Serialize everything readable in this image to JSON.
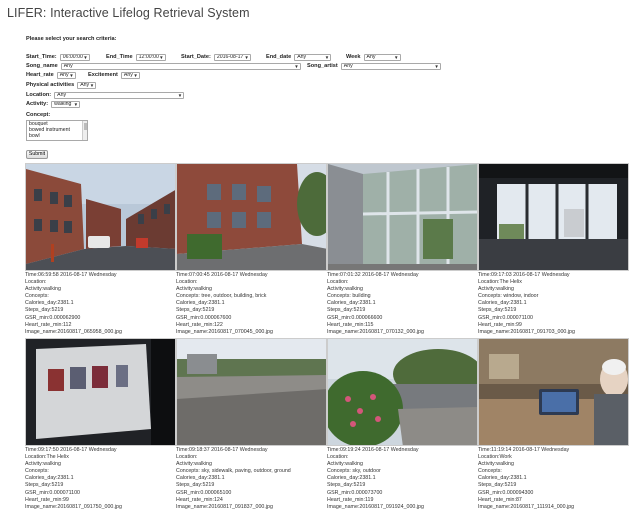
{
  "app": {
    "title": "LIFER: Interactive Lifelog Retrieval System"
  },
  "form": {
    "prompt": "Please select your search criteria:",
    "start_time": {
      "label": "Start_Time:",
      "value": "06:00:00"
    },
    "end_time": {
      "label": "End_Time",
      "value": "12:00:00"
    },
    "start_date": {
      "label": "Start_Date:",
      "value": "2016-08-17"
    },
    "end_date": {
      "label": "End_date",
      "value": "Any"
    },
    "week": {
      "label": "Week",
      "value": "Any"
    },
    "song_name": {
      "label": "Song_name",
      "value": "Any"
    },
    "song_artist": {
      "label": "Song_artist",
      "value": "Any"
    },
    "heart_rate": {
      "label": "Heart_rate",
      "value": "Any"
    },
    "excitement": {
      "label": "Excitement",
      "value": "Any"
    },
    "physical_activities": {
      "label": "Physical activities",
      "value": "Any"
    },
    "location": {
      "label": "Location:",
      "value": "Any"
    },
    "activity": {
      "label": "Activity:",
      "value": "walking"
    },
    "concept": {
      "label": "Concept:",
      "options": [
        "bouquet",
        "bowed instrument",
        "bowl"
      ]
    },
    "submit_label": "Submit"
  },
  "results": [
    {
      "time": "Time:06:59:58  2016-08-17  Wednesday",
      "location": "Location:",
      "activity": "Activity:walking",
      "concepts": "Concepts:",
      "calories": "Calories_day:2381.1",
      "steps": "Steps_day:5219",
      "gsr": "GSR_min:0.000062900",
      "heart": "Heart_rate_min:112",
      "image": "Image_name:20160817_065958_000.jpg"
    },
    {
      "time": "Time:07:00:45  2016-08-17  Wednesday",
      "location": "Location:",
      "activity": "Activity:walking",
      "concepts": "Concepts: tree, outdoor, building, brick",
      "calories": "Calories_day:2381.1",
      "steps": "Steps_day:5219",
      "gsr": "GSR_min:0.000067600",
      "heart": "Heart_rate_min:122",
      "image": "Image_name:20160817_070045_000.jpg"
    },
    {
      "time": "Time:07:01:32  2016-08-17  Wednesday",
      "location": "Location:",
      "activity": "Activity:walking",
      "concepts": "Concepts: building",
      "calories": "Calories_day:2381.1",
      "steps": "Steps_day:5219",
      "gsr": "GSR_min:0.000066600",
      "heart": "Heart_rate_min:115",
      "image": "Image_name:20160817_070132_000.jpg"
    },
    {
      "time": "Time:09:17:03  2016-08-17  Wednesday",
      "location": "Location:The Helix",
      "activity": "Activity:walking",
      "concepts": "Concepts: window, indoor",
      "calories": "Calories_day:2381.1",
      "steps": "Steps_day:5219",
      "gsr": "GSR_min:0.000071100",
      "heart": "Heart_rate_min:99",
      "image": "Image_name:20160817_091703_000.jpg"
    },
    {
      "time": "Time:09:17:50  2016-08-17  Wednesday",
      "location": "Location:The Helix",
      "activity": "Activity:walking",
      "concepts": "Concepts:",
      "calories": "Calories_day:2381.1",
      "steps": "Steps_day:5219",
      "gsr": "GSR_min:0.000071100",
      "heart": "Heart_rate_min:99",
      "image": "Image_name:20160817_091750_000.jpg"
    },
    {
      "time": "Time:09:18:37  2016-08-17  Wednesday",
      "location": "Location:",
      "activity": "Activity:walking",
      "concepts": "Concepts: sky, sidewalk, paving, outdoor, ground",
      "calories": "Calories_day:2381.1",
      "steps": "Steps_day:5219",
      "gsr": "GSR_min:0.000065100",
      "heart": "Heart_rate_min:124",
      "image": "Image_name:20160817_091837_000.jpg"
    },
    {
      "time": "Time:09:19:24  2016-08-17  Wednesday",
      "location": "Location:",
      "activity": "Activity:walking",
      "concepts": "Concepts: sky, outdoor",
      "calories": "Calories_day:2381.1",
      "steps": "Steps_day:5219",
      "gsr": "GSR_min:0.000073700",
      "heart": "Heart_rate_min:119",
      "image": "Image_name:20160817_091924_000.jpg"
    },
    {
      "time": "Time:11:19:14  2016-08-17  Wednesday",
      "location": "Location:Work",
      "activity": "Activity:walking",
      "concepts": "Concepts:",
      "calories": "Calories_day:2381.1",
      "steps": "Steps_day:5219",
      "gsr": "GSR_min:0.000094300",
      "heart": "Heart_rate_min:87",
      "image": "Image_name:20160817_111914_000.jpg"
    }
  ]
}
